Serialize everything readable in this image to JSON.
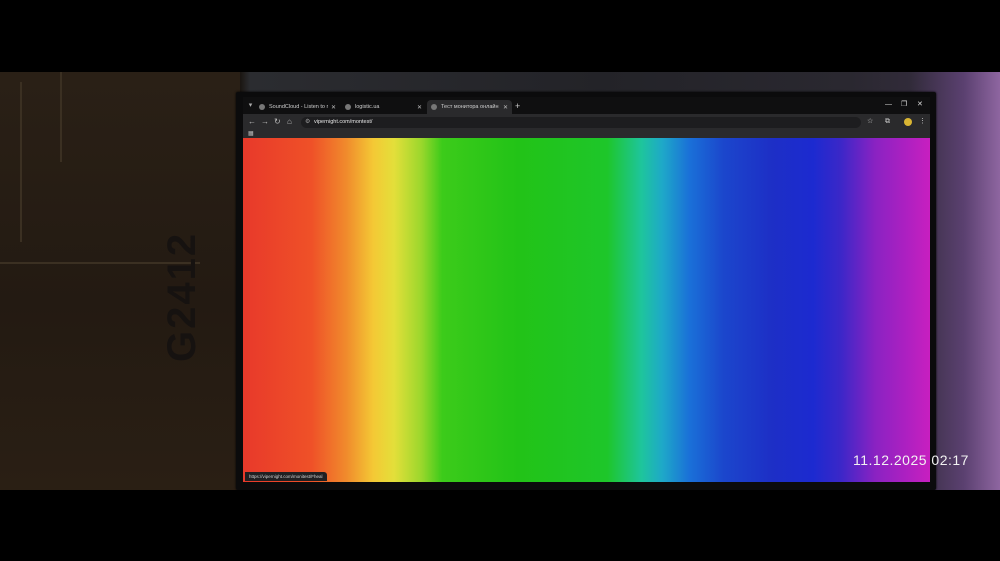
{
  "browser": {
    "tabs": [
      {
        "title": "SoundCloud - Listen to music",
        "active": false
      },
      {
        "title": "logistic.ua",
        "active": false
      },
      {
        "title": "Тест монитора онлайн - мон",
        "active": true
      }
    ],
    "address": "vipernight.com/montest/",
    "status_url": "https://vipernight.com/monitest/Fheal",
    "icons": {
      "tab_search": "chevron-down-icon",
      "new_tab": "plus-icon",
      "back": "arrow-left-icon",
      "forward": "arrow-right-icon",
      "reload": "reload-icon",
      "home": "home-icon",
      "bookmark": "star-icon",
      "extensions": "puzzle-icon",
      "menu": "kebab-menu-icon"
    }
  },
  "monitor_box": {
    "brand_print": "G2412"
  },
  "overlay": {
    "timestamp": "11.12.2025 02:17"
  }
}
